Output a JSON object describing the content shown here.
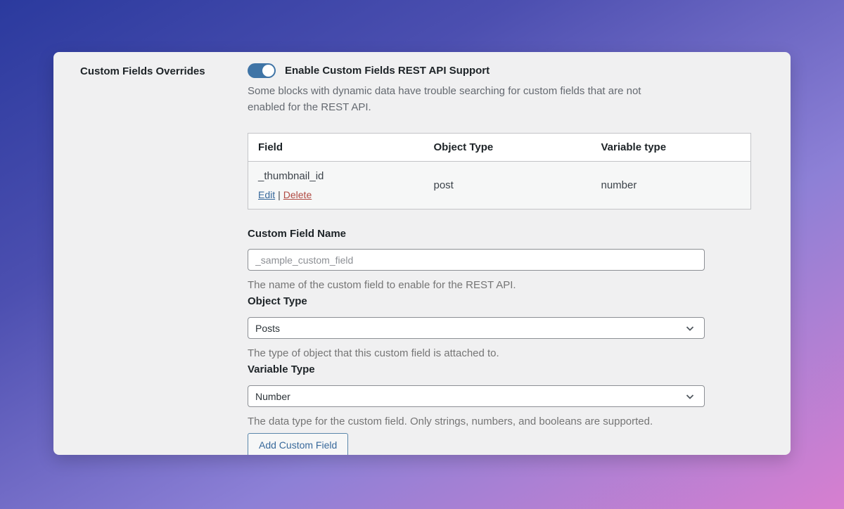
{
  "colors": {
    "accent_blue": "#3f74a6",
    "link_blue": "#38699b",
    "delete_red": "#b04a42",
    "card_bg": "#f0f0f1",
    "gradient_start": "#2b3a9e",
    "gradient_end": "#d77fd0"
  },
  "panel": {
    "label": "Custom Fields Overrides",
    "toggle": {
      "label": "Enable Custom Fields REST API Support",
      "state": "on"
    },
    "description": "Some blocks with dynamic data have trouble searching for custom fields that are not enabled for the REST API.",
    "table": {
      "headers": [
        "Field",
        "Object Type",
        "Variable type"
      ],
      "rows": [
        {
          "field": "_thumbnail_id",
          "edit_label": "Edit",
          "separator": "|",
          "delete_label": "Delete",
          "object_type": "post",
          "variable_type": "number"
        }
      ]
    },
    "fields": {
      "custom_field_name": {
        "label": "Custom Field Name",
        "placeholder": "_sample_custom_field",
        "help": "The name of the custom field to enable for the REST API."
      },
      "object_type": {
        "label": "Object Type",
        "value": "Posts",
        "help": "The type of object that this custom field is attached to."
      },
      "variable_type": {
        "label": "Variable Type",
        "value": "Number",
        "help": "The data type for the custom field. Only strings, numbers, and booleans are supported."
      }
    },
    "add_button_label": "Add Custom Field"
  }
}
